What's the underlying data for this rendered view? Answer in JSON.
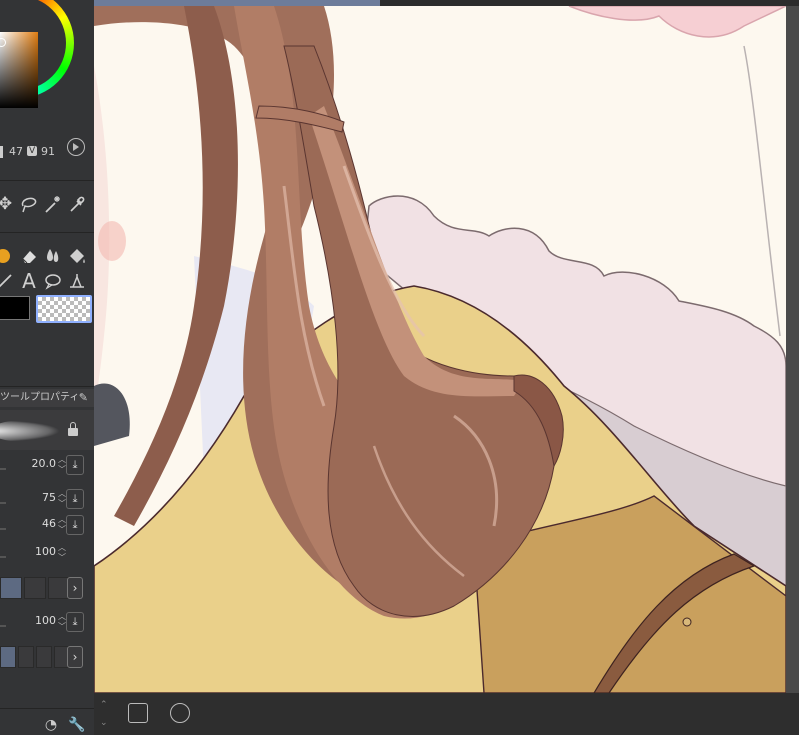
{
  "color_panel": {
    "hue_readout": "47",
    "value_label": "V",
    "value_readout": "91",
    "main_color": "#000000",
    "accent_color": "#e07d12"
  },
  "document_tab": {
    "title": ""
  },
  "tool_property": {
    "header_label": "ツールプロパティ",
    "params": [
      {
        "name": "brush-size",
        "value": "20.0"
      },
      {
        "name": "opacity-1",
        "value": "75"
      },
      {
        "name": "opacity-2",
        "value": "46"
      },
      {
        "name": "density",
        "value": "100"
      },
      {
        "name": "param-5",
        "value": "100"
      }
    ]
  },
  "icons": {
    "move": "move-icon",
    "lasso": "lasso-icon",
    "magic_wand": "magic-wand-icon",
    "eyedropper": "eyedropper-icon",
    "pen": "pen-icon",
    "eraser": "eraser-icon",
    "blend": "blend-icon",
    "fill": "fill-icon",
    "figure": "figure-icon",
    "text": "text-icon",
    "balloon": "balloon-icon",
    "line": "line-icon"
  }
}
